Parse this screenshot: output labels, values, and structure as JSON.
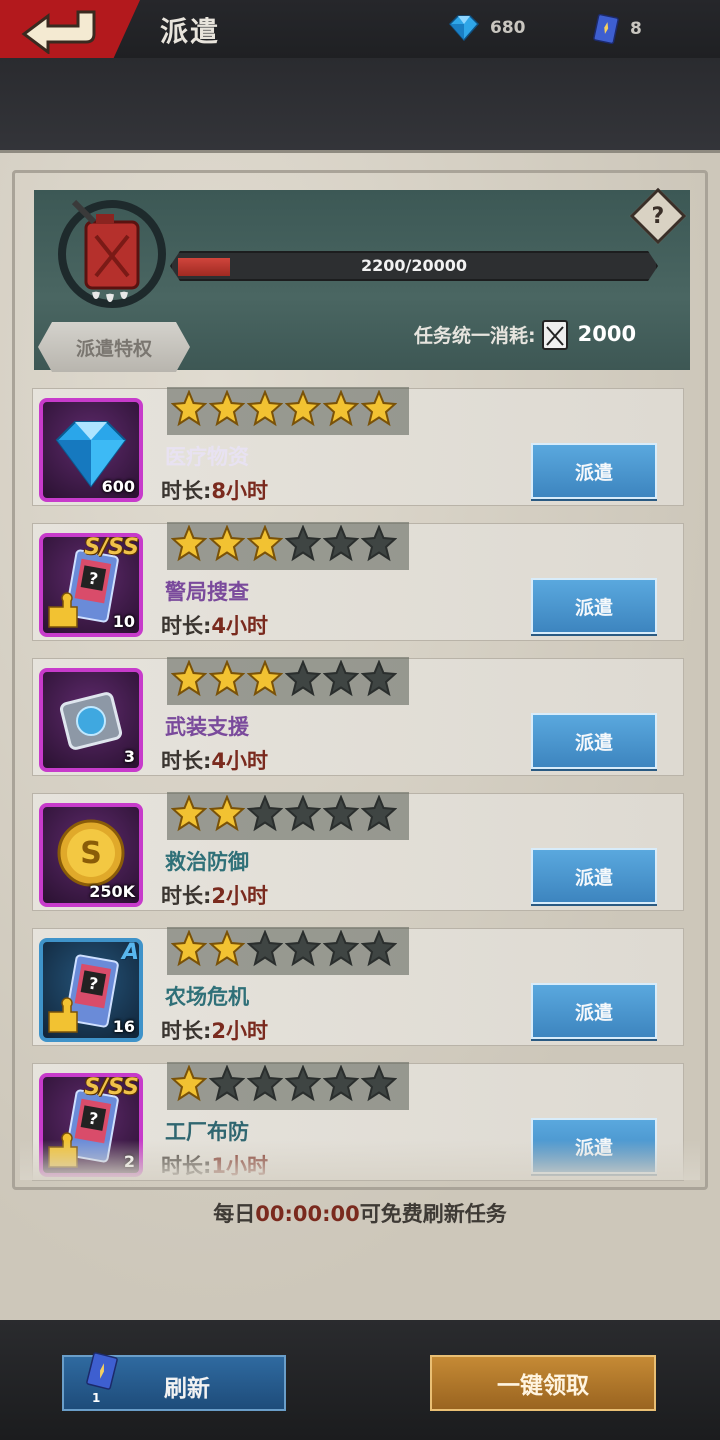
{
  "header": {
    "title": "派遣",
    "gems": "680",
    "tickets": "8"
  },
  "fuel": {
    "progress_text": "2200/20000",
    "current": 2200,
    "max": 20000,
    "privilege_label": "派遣特权",
    "consume_label": "任务统一消耗:",
    "consume_value": "2000",
    "help": "?"
  },
  "missions": [
    {
      "name": "医疗物资",
      "name_color": "#e8e2f2",
      "duration_label": "时长:",
      "duration_value": "8小时",
      "stars": 6,
      "max_stars": 6,
      "item_qty": "600",
      "item_icon": "diamond-icon",
      "frame": "purple",
      "grade": "",
      "button": "派遣"
    },
    {
      "name": "警局搜查",
      "name_color": "#7a4a9c",
      "duration_label": "时长:",
      "duration_value": "4小时",
      "stars": 3,
      "max_stars": 6,
      "item_qty": "10",
      "item_icon": "card-fragment-icon",
      "frame": "purple",
      "grade": "S/SS",
      "button": "派遣"
    },
    {
      "name": "武装支援",
      "name_color": "#7a4a9c",
      "duration_label": "时长:",
      "duration_value": "4小时",
      "stars": 3,
      "max_stars": 6,
      "item_qty": "3",
      "item_icon": "chip-icon",
      "frame": "purple",
      "grade": "",
      "button": "派遣"
    },
    {
      "name": "救治防御",
      "name_color": "#2f7078",
      "duration_label": "时长:",
      "duration_value": "2小时",
      "stars": 2,
      "max_stars": 6,
      "item_qty": "250K",
      "item_icon": "coin-icon",
      "frame": "purple",
      "grade": "",
      "button": "派遣"
    },
    {
      "name": "农场危机",
      "name_color": "#2f7078",
      "duration_label": "时长:",
      "duration_value": "2小时",
      "stars": 2,
      "max_stars": 6,
      "item_qty": "16",
      "item_icon": "card-fragment-icon",
      "frame": "blue",
      "grade": "A",
      "button": "派遣"
    },
    {
      "name": "工厂布防",
      "name_color": "#2f6670",
      "duration_label": "时长:",
      "duration_value": "1小时",
      "stars": 1,
      "max_stars": 6,
      "item_qty": "2",
      "item_icon": "card-fragment-icon",
      "frame": "purple",
      "grade": "S/SS",
      "button": "派遣"
    }
  ],
  "footer": {
    "note_prefix": "每日",
    "note_time": "00:00:00",
    "note_suffix": "可免费刷新任务",
    "refresh_label": "刷新",
    "refresh_cost": "1",
    "collect_label": "一键领取"
  }
}
